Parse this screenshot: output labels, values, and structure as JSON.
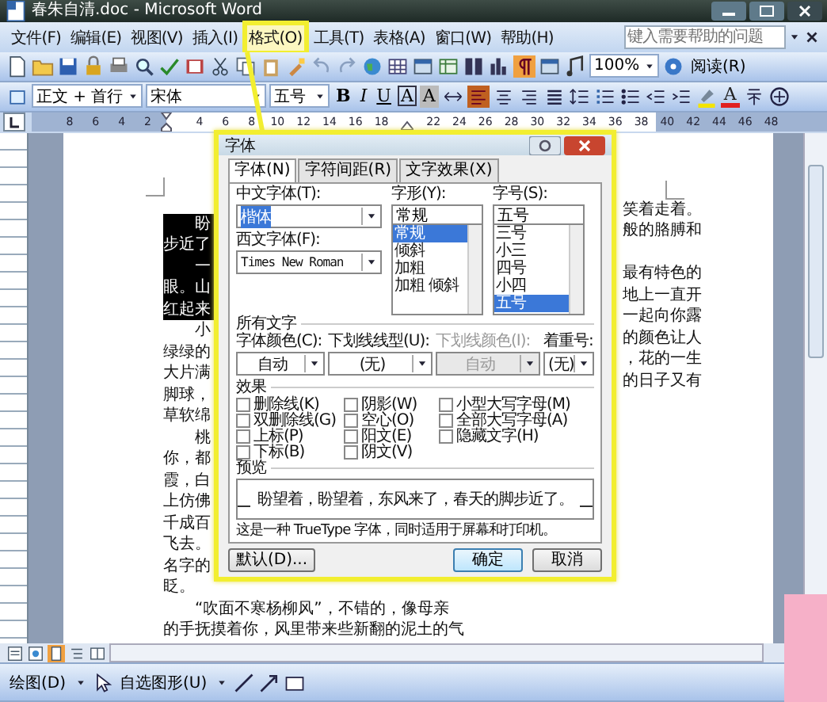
{
  "window": {
    "title": "春朱自清.doc - Microsoft Word"
  },
  "menus": [
    {
      "label": "文件(F)",
      "selected": false
    },
    {
      "label": "编辑(E)",
      "selected": false
    },
    {
      "label": "视图(V)",
      "selected": false
    },
    {
      "label": "插入(I)",
      "selected": false
    },
    {
      "label": "格式(O)",
      "selected": true
    },
    {
      "label": "工具(T)",
      "selected": false
    },
    {
      "label": "表格(A)",
      "selected": false
    },
    {
      "label": "窗口(W)",
      "selected": false
    },
    {
      "label": "帮助(H)",
      "selected": false
    }
  ],
  "help_box": {
    "placeholder": "键入需要帮助的问题"
  },
  "standard_toolbar": {
    "zoom": "100%",
    "read_button": "阅读(R)"
  },
  "formatting_toolbar": {
    "style": "正文 + 首行",
    "font": "宋体",
    "size": "五号",
    "buttons": [
      {
        "label": "B",
        "kind": "bold"
      },
      {
        "label": "I",
        "kind": "italic"
      },
      {
        "label": "U",
        "kind": "underline"
      },
      {
        "label": "A",
        "kind": "border"
      },
      {
        "label": "A",
        "kind": "shading"
      },
      {
        "label": "A",
        "kind": "color"
      }
    ]
  },
  "ruler": {
    "labels": [
      "8",
      "6",
      "4",
      "2",
      "4",
      "6",
      "8",
      "10",
      "12",
      "14",
      "16",
      "18",
      "22",
      "24",
      "26",
      "28",
      "30",
      "32",
      "34",
      "36",
      "38",
      "40",
      "42",
      "44",
      "46",
      "48"
    ]
  },
  "document": {
    "left_lines": [
      {
        "text": "盼",
        "selected": true,
        "first_line": true
      },
      {
        "text": "步近了",
        "selected": true,
        "first_line": false
      },
      {
        "text": "一",
        "selected": true,
        "first_line": true
      },
      {
        "text": "眼。山",
        "selected": true,
        "first_line": false
      },
      {
        "text": "红起来",
        "selected": true,
        "first_line": false
      },
      {
        "text": "小",
        "selected": false,
        "first_line": true
      },
      {
        "text": "绿绿的",
        "selected": false,
        "first_line": false
      },
      {
        "text": "大片满",
        "selected": false,
        "first_line": false
      },
      {
        "text": "脚球，",
        "selected": false,
        "first_line": false
      },
      {
        "text": "草软绵",
        "selected": false,
        "first_line": false
      },
      {
        "text": "桃",
        "selected": false,
        "first_line": true
      },
      {
        "text": "你，都",
        "selected": false,
        "first_line": false
      },
      {
        "text": "霞，白",
        "selected": false,
        "first_line": false
      },
      {
        "text": "上仿佛",
        "selected": false,
        "first_line": false
      },
      {
        "text": "千成百",
        "selected": false,
        "first_line": false
      },
      {
        "text": "飞去。",
        "selected": false,
        "first_line": false
      },
      {
        "text": "名字的",
        "selected": false,
        "first_line": false
      },
      {
        "text": "眨。",
        "selected": false,
        "first_line": false
      }
    ],
    "right_paragraphs": [
      [
        "笑着走着。",
        "般的胳膊和"
      ],
      [
        "最有特色的",
        "地上一直开",
        "一起向你露",
        "的颜色让人",
        "，花的一生",
        "的日子又有"
      ]
    ],
    "bottom_lines": [
      {
        "text": "“吹面不寒杨柳风”，不错的，像母亲",
        "first_line": true
      },
      {
        "text": "的手抚摸着你，风里带来些新翻的泥土的气",
        "first_line": false
      }
    ]
  },
  "font_dialog": {
    "title": "字体",
    "tabs": [
      {
        "label": "字体(N)",
        "selected": true
      },
      {
        "label": "字符间距(R)",
        "selected": false
      },
      {
        "label": "文字效果(X)",
        "selected": false
      }
    ],
    "chinese_font": {
      "label": "中文字体(T):",
      "value": "楷体"
    },
    "western_font": {
      "label": "西文字体(F):",
      "value": "Times New Roman"
    },
    "style": {
      "label": "字形(Y):",
      "value": "常规",
      "options": [
        {
          "label": "常规",
          "selected": true
        },
        {
          "label": "倾斜",
          "selected": false
        },
        {
          "label": "加粗",
          "selected": false
        },
        {
          "label": "加粗 倾斜",
          "selected": false
        }
      ]
    },
    "size": {
      "label": "字号(S):",
      "value": "五号",
      "options": [
        {
          "label": "三号",
          "selected": false
        },
        {
          "label": "小三",
          "selected": false
        },
        {
          "label": "四号",
          "selected": false
        },
        {
          "label": "小四",
          "selected": false
        },
        {
          "label": "五号",
          "selected": true
        }
      ]
    },
    "all_text": {
      "title": "所有文字",
      "fields": [
        {
          "label": "字体颜色(C):",
          "value": "自动",
          "disabled": false
        },
        {
          "label": "下划线线型(U):",
          "value": "(无)",
          "disabled": false
        },
        {
          "label": "下划线颜色(I):",
          "value": "自动",
          "disabled": true
        },
        {
          "label": "着重号:",
          "value": "(无)",
          "disabled": false
        }
      ]
    },
    "effects": {
      "title": "效果",
      "columns": [
        [
          {
            "label": "删除线(K)",
            "checked": false
          },
          {
            "label": "双删除线(G)",
            "checked": false
          },
          {
            "label": "上标(P)",
            "checked": false
          },
          {
            "label": "下标(B)",
            "checked": false
          }
        ],
        [
          {
            "label": "阴影(W)",
            "checked": false
          },
          {
            "label": "空心(O)",
            "checked": false
          },
          {
            "label": "阳文(E)",
            "checked": false
          },
          {
            "label": "阴文(V)",
            "checked": false
          }
        ],
        [
          {
            "label": "小型大写字母(M)",
            "checked": false
          },
          {
            "label": "全部大写字母(A)",
            "checked": false
          },
          {
            "label": "隐藏文字(H)",
            "checked": false
          }
        ]
      ]
    },
    "preview": {
      "title": "预览",
      "text": "盼望着，盼望着，东风来了，春天的脚步近了。"
    },
    "note": "这是一种 TrueType 字体，同时适用于屏幕和打印机。",
    "buttons": [
      {
        "label": "默认(D)...",
        "kind": "default"
      },
      {
        "label": "确定",
        "kind": "primary"
      },
      {
        "label": "取消",
        "kind": "normal"
      }
    ]
  },
  "drawing_toolbar": {
    "draw_menu": "绘图(D)",
    "autoshapes_menu": "自选图形(U)"
  }
}
